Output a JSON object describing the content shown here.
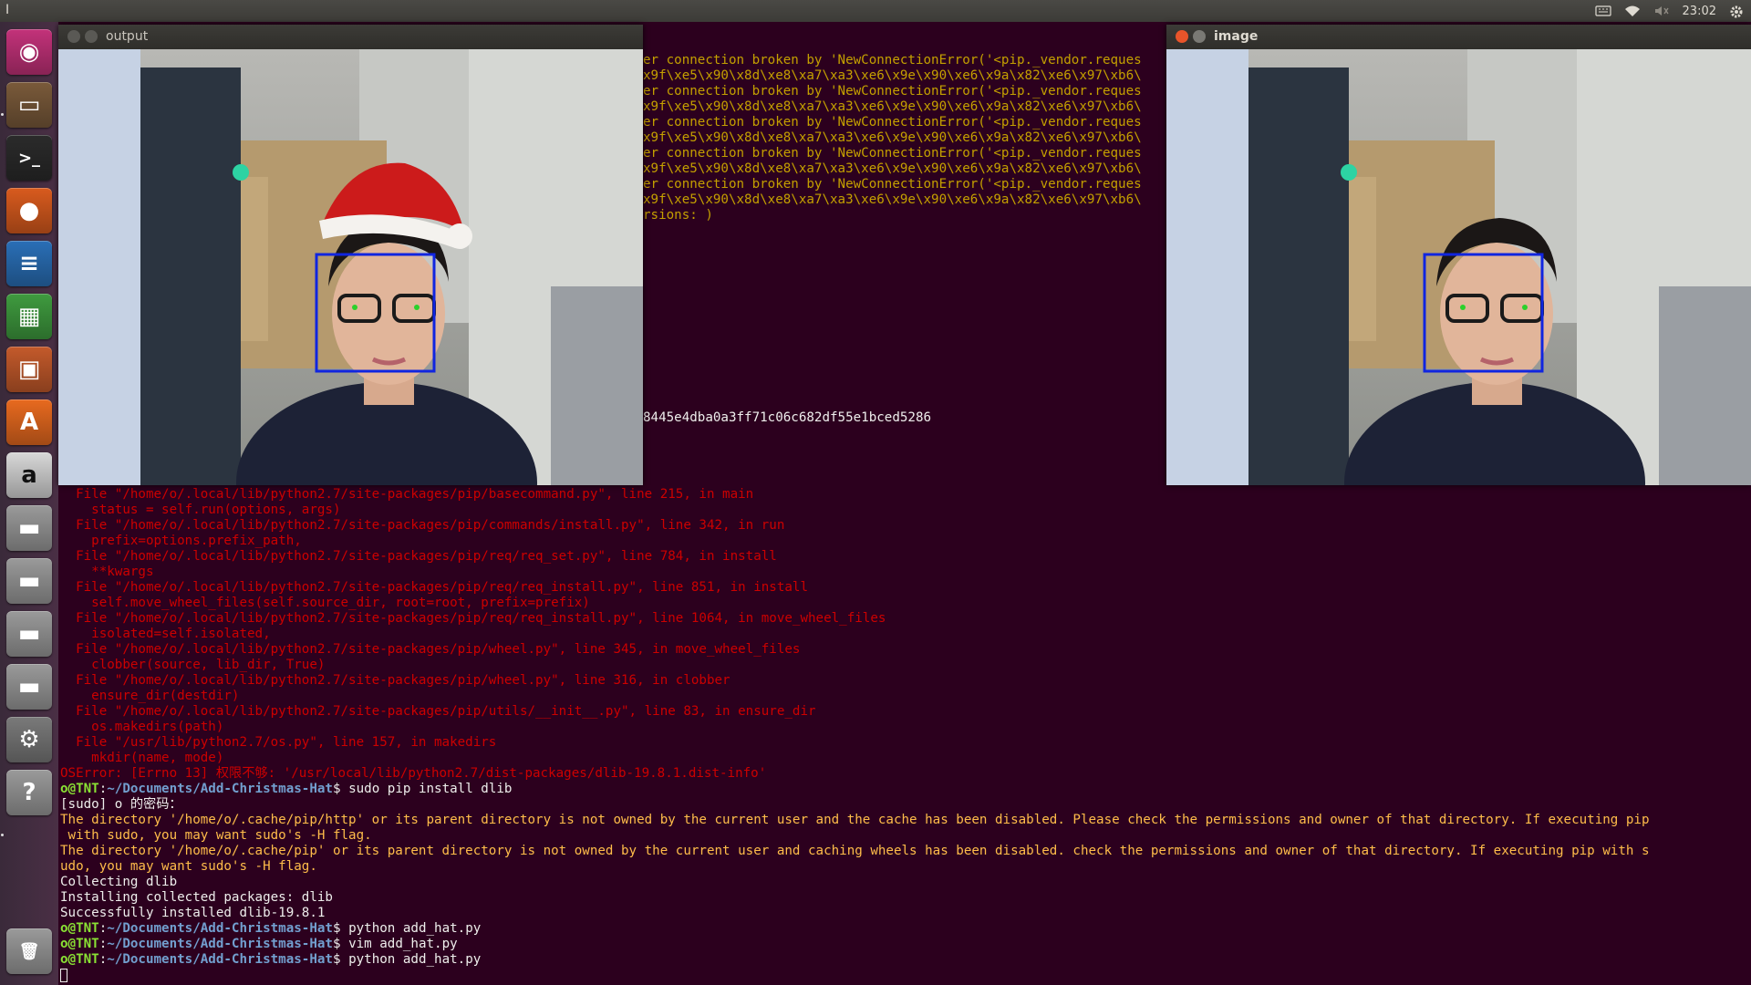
{
  "topbar": {
    "left_glyph": "I",
    "clock": "23:02",
    "indicators": [
      "keyboard-icon",
      "wifi-icon",
      "speaker-muted-icon",
      "gear-icon"
    ]
  },
  "launcher": {
    "items": [
      {
        "name": "ubuntu-dash",
        "label": "Search your computer",
        "color": "#c3327a"
      },
      {
        "name": "files",
        "label": "Files",
        "color": "#7a5a3a"
      },
      {
        "name": "terminal",
        "label": "Terminal",
        "color": "#2b2b2b"
      },
      {
        "name": "firefox",
        "label": "Firefox",
        "color": "#d95b1e"
      },
      {
        "name": "writer",
        "label": "LibreOffice Writer",
        "color": "#2a6fb7"
      },
      {
        "name": "calc",
        "label": "LibreOffice Calc",
        "color": "#3f9b3f"
      },
      {
        "name": "impress",
        "label": "LibreOffice Impress",
        "color": "#c45a2b"
      },
      {
        "name": "software-center",
        "label": "Ubuntu Software",
        "color": "#e86a1f"
      },
      {
        "name": "amazon",
        "label": "Amazon",
        "color": "#d8d8d8"
      },
      {
        "name": "drive-1",
        "label": "Drive",
        "color": "#9a9a9a"
      },
      {
        "name": "drive-2",
        "label": "Drive",
        "color": "#9a9a9a"
      },
      {
        "name": "drive-3",
        "label": "Drive",
        "color": "#9a9a9a"
      },
      {
        "name": "drive-4",
        "label": "Drive",
        "color": "#9a9a9a"
      },
      {
        "name": "system-settings",
        "label": "System Settings",
        "color": "#7a7a7a"
      },
      {
        "name": "help",
        "label": "Help",
        "color": "#9a9a9a"
      },
      {
        "name": "trash",
        "label": "Trash",
        "color": "#9a9a9a"
      }
    ]
  },
  "windows": {
    "output": {
      "title": "output"
    },
    "image": {
      "title": "image"
    }
  },
  "terminal": {
    "top_lines": [
      "er connection broken by 'NewConnectionError('<pip._vendor.reques",
      "x9f\\xe5\\x90\\x8d\\xe8\\xa7\\xa3\\xe6\\x9e\\x90\\xe6\\x9a\\x82\\xe6\\x97\\xb6\\",
      "er connection broken by 'NewConnectionError('<pip._vendor.reques",
      "x9f\\xe5\\x90\\x8d\\xe8\\xa7\\xa3\\xe6\\x9e\\x90\\xe6\\x9a\\x82\\xe6\\x97\\xb6\\",
      "er connection broken by 'NewConnectionError('<pip._vendor.reques",
      "x9f\\xe5\\x90\\x8d\\xe8\\xa7\\xa3\\xe6\\x9e\\x90\\xe6\\x9a\\x82\\xe6\\x97\\xb6\\",
      "er connection broken by 'NewConnectionError('<pip._vendor.reques",
      "x9f\\xe5\\x90\\x8d\\xe8\\xa7\\xa3\\xe6\\x9e\\x90\\xe6\\x9a\\x82\\xe6\\x97\\xb6\\",
      "er connection broken by 'NewConnectionError('<pip._vendor.reques",
      "x9f\\xe5\\x90\\x8d\\xe8\\xa7\\xa3\\xe6\\x9e\\x90\\xe6\\x9a\\x82\\xe6\\x97\\xb6\\",
      "rsions: )"
    ],
    "hash_line": "8445e4dba0a3ff71c06c682df55e1bced5286",
    "traceback": [
      "  File \"/home/o/.local/lib/python2.7/site-packages/pip/basecommand.py\", line 215, in main",
      "    status = self.run(options, args)",
      "  File \"/home/o/.local/lib/python2.7/site-packages/pip/commands/install.py\", line 342, in run",
      "    prefix=options.prefix_path,",
      "  File \"/home/o/.local/lib/python2.7/site-packages/pip/req/req_set.py\", line 784, in install",
      "    **kwargs",
      "  File \"/home/o/.local/lib/python2.7/site-packages/pip/req/req_install.py\", line 851, in install",
      "    self.move_wheel_files(self.source_dir, root=root, prefix=prefix)",
      "  File \"/home/o/.local/lib/python2.7/site-packages/pip/req/req_install.py\", line 1064, in move_wheel_files",
      "    isolated=self.isolated,",
      "  File \"/home/o/.local/lib/python2.7/site-packages/pip/wheel.py\", line 345, in move_wheel_files",
      "    clobber(source, lib_dir, True)",
      "  File \"/home/o/.local/lib/python2.7/site-packages/pip/wheel.py\", line 316, in clobber",
      "    ensure_dir(destdir)",
      "  File \"/home/o/.local/lib/python2.7/site-packages/pip/utils/__init__.py\", line 83, in ensure_dir",
      "    os.makedirs(path)",
      "  File \"/usr/lib/python2.7/os.py\", line 157, in makedirs",
      "    mkdir(name, mode)",
      "OSError: [Errno 13] 权限不够: '/usr/local/lib/python2.7/dist-packages/dlib-19.8.1.dist-info'"
    ],
    "prompt_user": "o@TNT",
    "prompt_path": "~/Documents/Add-Christmas-Hat",
    "cmd1": "sudo pip install dlib",
    "sudo_prompt": "[sudo] o 的密码：",
    "warn1a": "The directory '/home/o/.cache/pip/http' or its parent directory is not owned by the current user and the cache has been disabled. Please check the permissions and owner of that directory. If executing pip",
    "warn1b": " with sudo, you may want sudo's -H flag.",
    "warn2a": "The directory '/home/o/.cache/pip' or its parent directory is not owned by the current user and caching wheels has been disabled. check the permissions and owner of that directory. If executing pip with s",
    "warn2b": "udo, you may want sudo's -H flag.",
    "out1": "Collecting dlib",
    "out2": "Installing collected packages: dlib",
    "out3": "Successfully installed dlib-19.8.1",
    "cmd2": "python add_hat.py",
    "cmd3": "vim add_hat.py",
    "cmd4": "python add_hat.py"
  }
}
